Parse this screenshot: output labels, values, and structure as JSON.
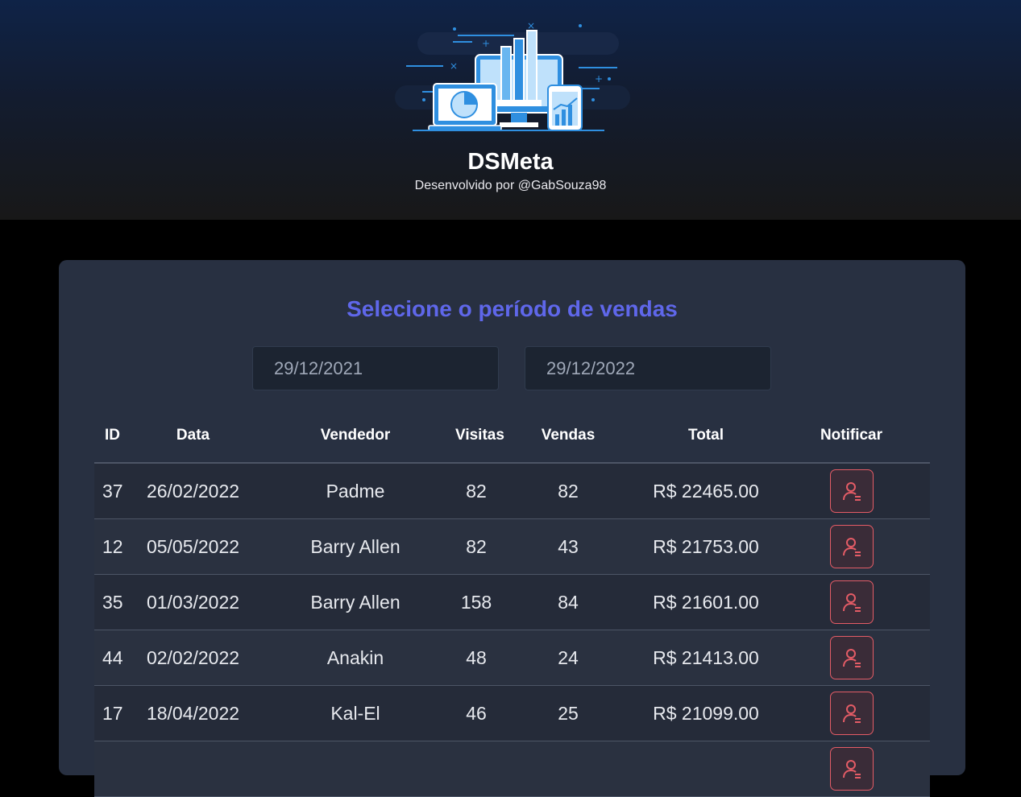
{
  "header": {
    "logo_icon": "dashboard-devices-illustration",
    "title": "DSMeta",
    "subtitle": "Desenvolvido por @GabSouza98"
  },
  "filter": {
    "title": "Selecione o período de vendas",
    "min_date": "29/12/2021",
    "max_date": "29/12/2022"
  },
  "table": {
    "headers": {
      "id": "ID",
      "date": "Data",
      "seller": "Vendedor",
      "visits": "Visitas",
      "sales": "Vendas",
      "total": "Total",
      "notify": "Notificar"
    },
    "rows": [
      {
        "id": "37",
        "date": "26/02/2022",
        "seller": "Padme",
        "visits": "82",
        "sales": "82",
        "total": "R$ 22465.00"
      },
      {
        "id": "12",
        "date": "05/05/2022",
        "seller": "Barry Allen",
        "visits": "82",
        "sales": "43",
        "total": "R$ 21753.00"
      },
      {
        "id": "35",
        "date": "01/03/2022",
        "seller": "Barry Allen",
        "visits": "158",
        "sales": "84",
        "total": "R$ 21601.00"
      },
      {
        "id": "44",
        "date": "02/02/2022",
        "seller": "Anakin",
        "visits": "48",
        "sales": "24",
        "total": "R$ 21413.00"
      },
      {
        "id": "17",
        "date": "18/04/2022",
        "seller": "Kal-El",
        "visits": "46",
        "sales": "25",
        "total": "R$ 21099.00"
      },
      {
        "id": "",
        "date": "",
        "seller": "",
        "visits": "",
        "sales": "",
        "total": ""
      }
    ],
    "notify_icon": "user-notify-icon"
  },
  "colors": {
    "accent": "#5f67ea",
    "notify": "#e45c66",
    "card": "#283041",
    "header_top": "#0f2347"
  }
}
